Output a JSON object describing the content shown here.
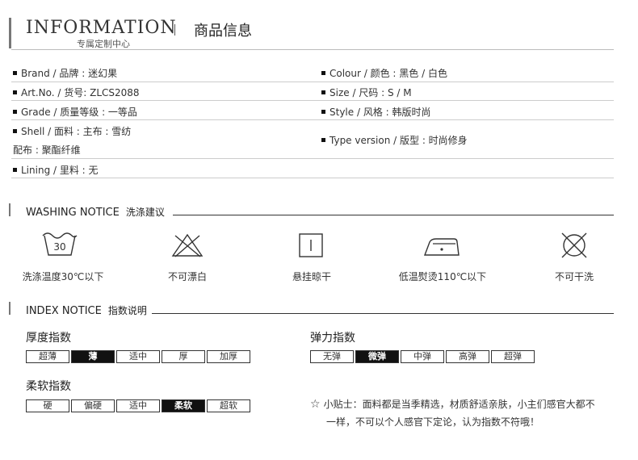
{
  "header": {
    "title_en": "INFORMATION",
    "title_cn": "商品信息",
    "subtitle": "专属定制中心"
  },
  "info": {
    "brand": "Brand / 品牌 : 迷幻果",
    "colour": "Colour / 颜色 : 黑色 / 白色",
    "artno": "Art.No. / 货号: ZLCS2088",
    "size": "Size / 尺码 :  S / M",
    "grade": "Grade / 质量等级 : 一等品",
    "style": "Style / 风格 : 韩版时尚",
    "shell": "Shell / 面料 :  主布 : 雪纺",
    "shell2": "配布 : 聚酯纤维",
    "type_version": "Type version / 版型 : 时尚修身",
    "lining": "Lining / 里料 : 无"
  },
  "washing": {
    "title_en": "WASHING NOTICE",
    "title_cn": "洗涤建议",
    "temp_number": "30",
    "items": [
      {
        "icon": "wash-30-icon",
        "label": "洗涤温度30℃以下"
      },
      {
        "icon": "no-bleach-icon",
        "label": "不可漂白"
      },
      {
        "icon": "hang-dry-icon",
        "label": "悬挂晾干"
      },
      {
        "icon": "iron-low-icon",
        "label": "低温熨烫110℃以下"
      },
      {
        "icon": "no-dry-clean-icon",
        "label": "不可干洗"
      }
    ]
  },
  "index": {
    "title_en": "INDEX NOTICE",
    "title_cn": "指数说明",
    "thickness": {
      "title": "厚度指数",
      "options": [
        "超薄",
        "薄",
        "适中",
        "厚",
        "加厚"
      ],
      "selected": "薄"
    },
    "elasticity": {
      "title": "弹力指数",
      "options": [
        "无弹",
        "微弹",
        "中弹",
        "高弹",
        "超弹"
      ],
      "selected": "微弹"
    },
    "softness": {
      "title": "柔软指数",
      "options": [
        "硬",
        "偏硬",
        "适中",
        "柔软",
        "超软"
      ],
      "selected": "柔软"
    },
    "tip_star": "☆",
    "tip_line1": "小贴士：面料都是当季精选，材质舒适亲肤，小主们感官大都不",
    "tip_line2": "一样，不可以个人感官下定论，认为指数不符哦！"
  }
}
